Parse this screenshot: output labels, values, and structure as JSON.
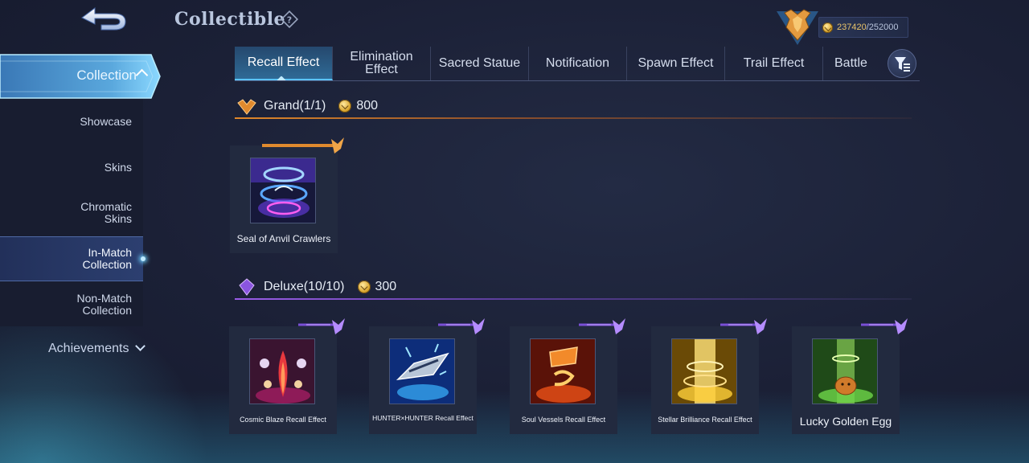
{
  "header": {
    "title": "Collectible",
    "points_current": "237420",
    "points_separator": "/",
    "points_max": "252000"
  },
  "sidebar": {
    "section_label": "Collection",
    "items": [
      {
        "label": "Showcase"
      },
      {
        "label": "Skins"
      },
      {
        "label": "Chromatic\nSkins"
      },
      {
        "label": "In-Match\nCollection",
        "active": true
      },
      {
        "label": "Non-Match\nCollection"
      }
    ],
    "achievements_label": "Achievements"
  },
  "tabs": [
    {
      "label": "Recall Effect",
      "active": true
    },
    {
      "label": "Elimination\nEffect"
    },
    {
      "label": "Sacred Statue"
    },
    {
      "label": "Notification"
    },
    {
      "label": "Spawn Effect"
    },
    {
      "label": "Trail Effect"
    },
    {
      "label": "Battle E"
    }
  ],
  "sections": {
    "grand": {
      "label": "Grand(1/1)",
      "cost": "800",
      "items": [
        {
          "name": "Seal of Anvil Crawlers"
        }
      ]
    },
    "deluxe": {
      "label": "Deluxe(10/10)",
      "cost": "300",
      "items": [
        {
          "name": "Cosmic Blaze Recall Effect"
        },
        {
          "name": "HUNTER×HUNTER Recall Effect"
        },
        {
          "name": "Soul Vessels Recall Effect"
        },
        {
          "name": "Stellar Brilliance Recall Effect"
        },
        {
          "name": "Lucky Golden Egg"
        }
      ]
    }
  },
  "colors": {
    "accent_blue": "#5bc4ff",
    "grand_orange": "#e0872a",
    "deluxe_purple": "#9a5ce8",
    "points_gold": "#e9c46a"
  }
}
